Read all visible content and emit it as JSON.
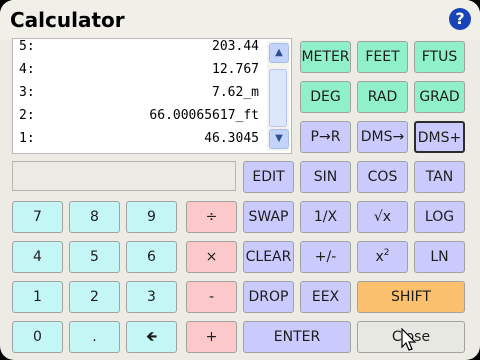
{
  "window": {
    "title": "Calculator",
    "help_label": "?"
  },
  "stack": [
    {
      "level": "5:",
      "value": "203.44"
    },
    {
      "level": "4:",
      "value": "12.767"
    },
    {
      "level": "3:",
      "value": "7.62_m"
    },
    {
      "level": "2:",
      "value": "66.00065617_ft"
    },
    {
      "level": "1:",
      "value": "46.3045"
    }
  ],
  "scroll": {
    "up_icon": "▲",
    "down_icon": "▼"
  },
  "entry": {
    "value": ""
  },
  "buttons": {
    "meter": "METER",
    "feet": "FEET",
    "ftus": "FTUS",
    "deg": "DEG",
    "rad": "RAD",
    "grad": "GRAD",
    "p_to_r": "P→R",
    "dms_to": "DMS→",
    "dms_plus": "DMS+",
    "edit": "EDIT",
    "sin": "SIN",
    "cos": "COS",
    "tan": "TAN",
    "seven": "7",
    "eight": "8",
    "nine": "9",
    "divide": "÷",
    "swap": "SWAP",
    "reciprocal": "1/X",
    "sqrt": "√x",
    "log": "LOG",
    "four": "4",
    "five": "5",
    "six": "6",
    "multiply": "×",
    "clear": "CLEAR",
    "plus_minus": "+/-",
    "square": "x",
    "square_sup": "2",
    "ln": "LN",
    "one": "1",
    "two": "2",
    "three": "3",
    "minus": "-",
    "drop": "DROP",
    "eex": "EEX",
    "shift": "SHIFT",
    "zero": "0",
    "decimal": ".",
    "backspace": "🡸",
    "plus": "+",
    "enter": "ENTER",
    "close": "Close"
  },
  "colors": {
    "cyan": "#c3f6f4",
    "green": "#8ff0c9",
    "lavender": "#cacafc",
    "pink": "#fbc9c9",
    "gold": "#fbc06d",
    "help": "#1b43b8"
  }
}
